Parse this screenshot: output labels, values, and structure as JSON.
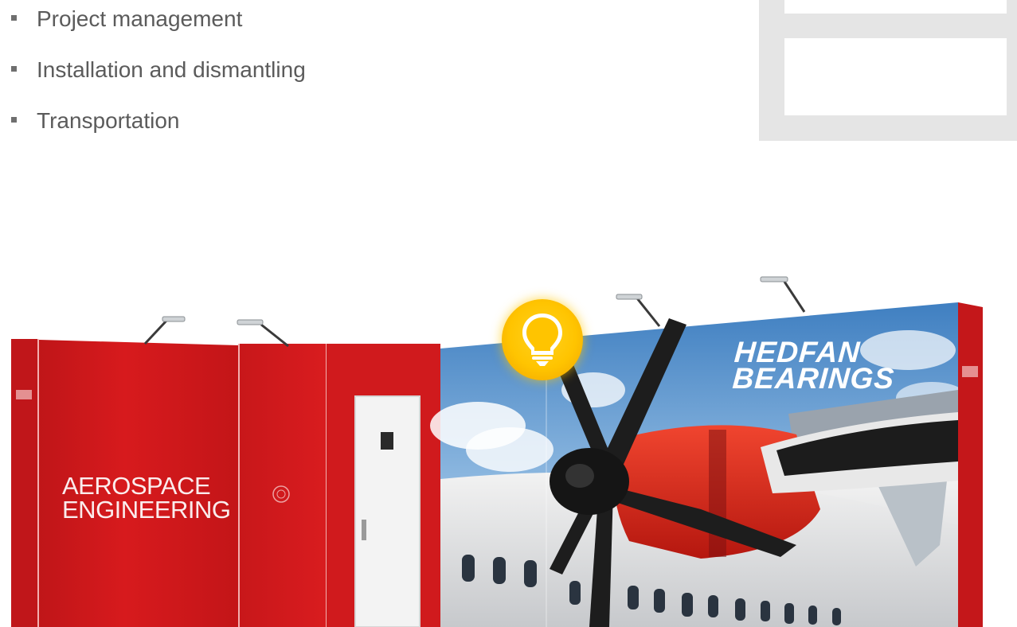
{
  "services": {
    "items": [
      {
        "label": "Project management"
      },
      {
        "label": "Installation and dismantling"
      },
      {
        "label": "Transportation"
      }
    ]
  },
  "stand": {
    "left_panel_text": "AEROSPACE\nENGINEERING",
    "right_panel_text": "HEDFAN\nBEARINGS",
    "colors": {
      "panel_red": "#d3181b",
      "sky_blue": "#4f8cc8",
      "badge_yellow": "#ffc400"
    }
  },
  "badge": {
    "icon": "lightbulb-icon"
  }
}
